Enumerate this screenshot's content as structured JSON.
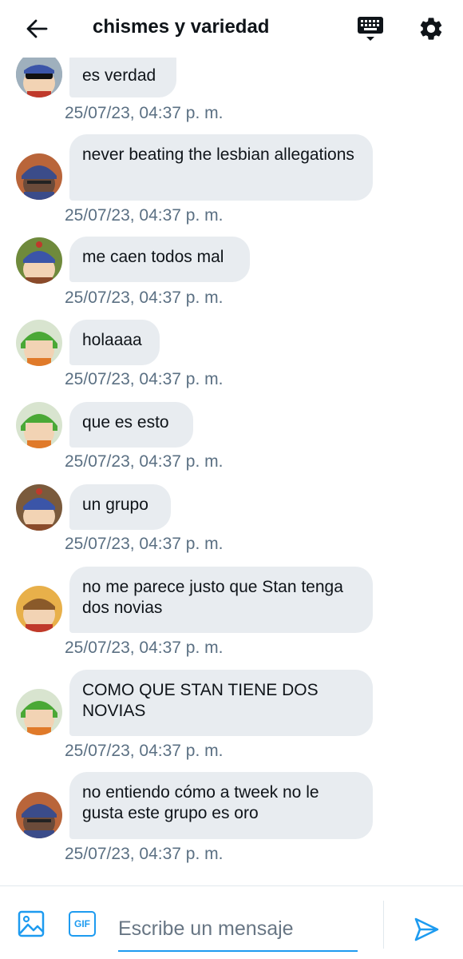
{
  "header": {
    "title": "chismes y variedad"
  },
  "messages": [
    {
      "text": "es verdad",
      "time": "25/07/23, 04:37 p. m.",
      "avatar": "stan-icon",
      "avatar_color": "#8a9aa8"
    },
    {
      "text": "never beating the lesbian allegations",
      "time": "25/07/23, 04:37 p. m.",
      "avatar": "craig-icon",
      "avatar_color": "#3b4c8a"
    },
    {
      "text": "me caen todos mal",
      "time": "25/07/23, 04:37 p. m.",
      "avatar": "stan-icon",
      "avatar_color": "#5e7b3a"
    },
    {
      "text": "holaaaa",
      "time": "25/07/23, 04:37 p. m.",
      "avatar": "kyle-icon",
      "avatar_color": "#4a9a36"
    },
    {
      "text": "que es esto",
      "time": "25/07/23, 04:37 p. m.",
      "avatar": "kyle-icon",
      "avatar_color": "#4a9a36"
    },
    {
      "text": "un grupo",
      "time": "25/07/23, 04:37 p. m.",
      "avatar": "stan-icon",
      "avatar_color": "#6a4a34"
    },
    {
      "text": "no me parece justo que Stan tenga dos novias",
      "time": "25/07/23, 04:37 p. m.",
      "avatar": "clyde-icon",
      "avatar_color": "#c08a3a"
    },
    {
      "text": "COMO QUE STAN TIENE DOS NOVIAS",
      "time": "25/07/23, 04:37 p. m.",
      "avatar": "kyle-icon",
      "avatar_color": "#4a9a36"
    },
    {
      "text": "no entiendo cómo a tweek no le gusta este grupo es oro",
      "time": "25/07/23, 04:37 p. m.",
      "avatar": "craig-icon",
      "avatar_color": "#3b4c8a"
    }
  ],
  "composer": {
    "placeholder": "Escribe un mensaje",
    "gif_label": "GIF"
  },
  "colors": {
    "accent": "#1d9bf0",
    "bubble": "#e8ecf0",
    "timestamp": "#5b7083",
    "text": "#0f1419"
  }
}
